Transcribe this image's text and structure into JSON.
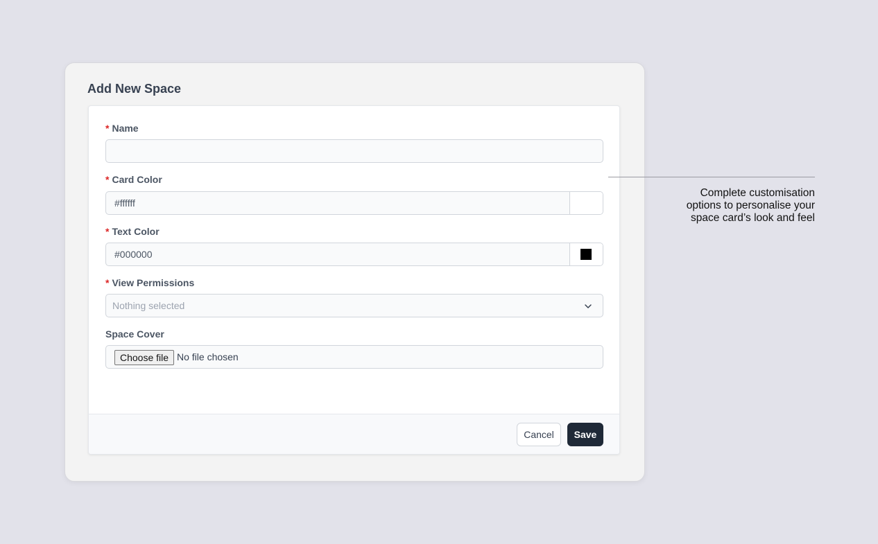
{
  "modal": {
    "title": "Add New Space"
  },
  "form": {
    "required_marker": "*",
    "name": {
      "label": "Name",
      "value": ""
    },
    "card_color": {
      "label": "Card Color",
      "value": "#ffffff",
      "swatch": "#ffffff"
    },
    "text_color": {
      "label": "Text Color",
      "value": "#000000",
      "swatch": "#000000"
    },
    "view_permissions": {
      "label": "View Permissions",
      "placeholder": "Nothing selected",
      "icon": "chevron-down-icon"
    },
    "space_cover": {
      "label": "Space Cover",
      "button_label": "Choose file",
      "status": "No file chosen"
    }
  },
  "footer": {
    "cancel_label": "Cancel",
    "save_label": "Save"
  },
  "callout": {
    "line1": "Complete customisation",
    "line2": "options to personalise your",
    "line3": "space card’s look and feel"
  },
  "colors": {
    "background": "#e2e2ea",
    "required": "#dc2626",
    "primary_button": "#1f2937"
  }
}
